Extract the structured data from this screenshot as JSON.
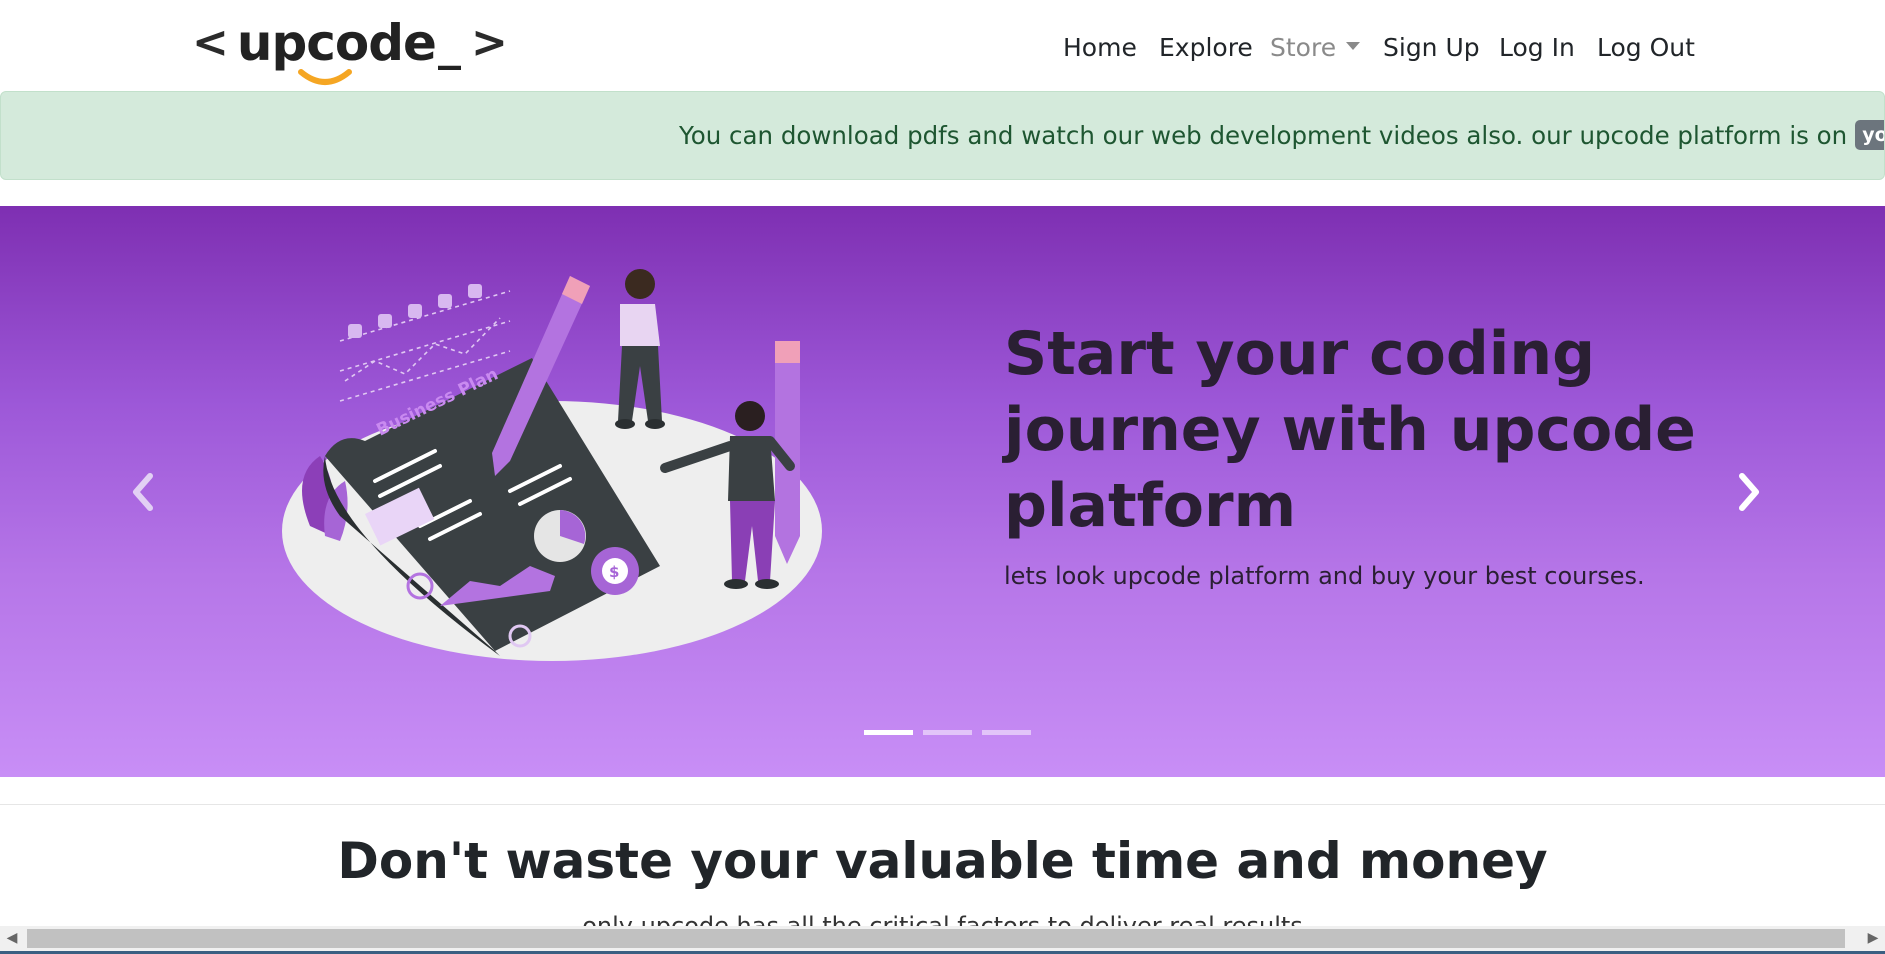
{
  "navbar": {
    "brand": {
      "open_bracket": "<",
      "word": "upcode",
      "cursor": "_",
      "close_bracket": ">"
    },
    "links": [
      {
        "label": "Home"
      },
      {
        "label": "Explore"
      },
      {
        "label": "Store",
        "dropdown": true
      },
      {
        "label": "Sign Up"
      },
      {
        "label": "Log In"
      },
      {
        "label": "Log Out"
      }
    ]
  },
  "alert": {
    "message": "You can download pdfs and watch our web development videos also. our upcode platform is on",
    "badge": "youtube"
  },
  "carousel": {
    "slide": {
      "title": "Start your coding journey with upcode platform",
      "subtitle": "lets look upcode platform and buy your best courses.",
      "illustration_text": "Business Plan"
    },
    "indicators": {
      "count": 3,
      "active": 0
    },
    "prev_icon": "chevron-left-icon",
    "next_icon": "chevron-right-icon"
  },
  "section": {
    "title": "Don't waste your valuable time and money",
    "subtitle": "only upcode has all the critical factors to deliver real results"
  },
  "colors": {
    "banner_bg": "#d4eadb",
    "banner_text": "#1e5631",
    "carousel_top": "#7e2fb2",
    "carousel_bottom": "#c88ef6",
    "logo_smile": "#f5a623"
  }
}
